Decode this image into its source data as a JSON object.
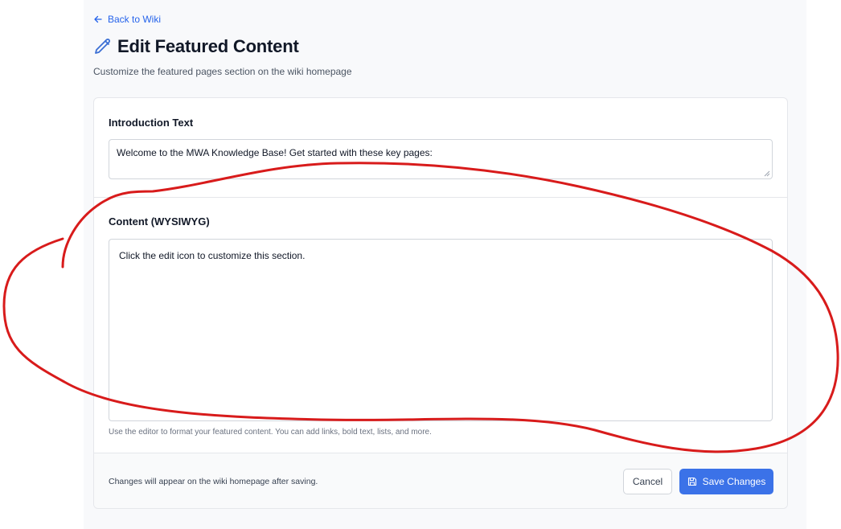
{
  "nav": {
    "back_label": "Back to Wiki",
    "back_icon": "arrow-left-icon"
  },
  "header": {
    "title": "Edit Featured Content",
    "title_icon": "pencil-icon",
    "subtitle": "Customize the featured pages section on the wiki homepage"
  },
  "form": {
    "intro": {
      "label": "Introduction Text",
      "value": "Welcome to the MWA Knowledge Base! Get started with these key pages:"
    },
    "content": {
      "label": "Content (WYSIWYG)",
      "value": "Click the edit icon to customize this section.",
      "help": "Use the editor to format your featured content. You can add links, bold text, lists, and more."
    }
  },
  "footer": {
    "note": "Changes will appear on the wiki homepage after saving.",
    "cancel_label": "Cancel",
    "save_label": "Save Changes",
    "save_icon": "floppy-disk-icon"
  },
  "colors": {
    "accent": "#2563eb",
    "save_button": "#3b72e8",
    "annotation_stroke": "#d81b1b"
  }
}
